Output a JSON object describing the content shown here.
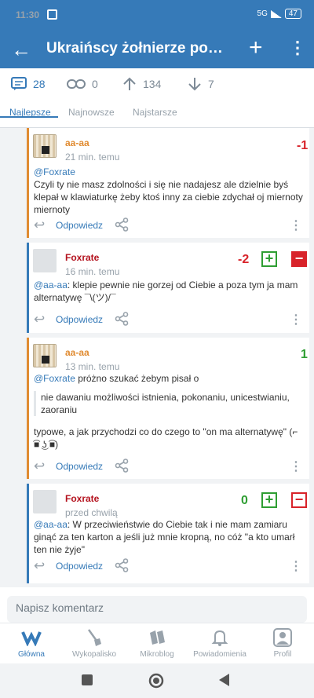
{
  "status": {
    "time": "11:30",
    "network": "5G",
    "battery": "47"
  },
  "appbar": {
    "title": "Ukraińscy żołnierze podd…",
    "back_icon": "arrow-left-icon",
    "add_icon": "plus-icon",
    "more_icon": "more-vert-icon"
  },
  "stats": {
    "comments": "28",
    "links": "0",
    "upvotes": "134",
    "downvotes": "7"
  },
  "tabs": [
    "Najlepsze",
    "Najnowsze",
    "Najstarsze"
  ],
  "colors": {
    "accent": "#367ab8",
    "green": "#2f9e33",
    "red": "#d8232a",
    "orange": "#e08b31"
  },
  "comments": [
    {
      "author": "aa-aa",
      "time": "21 min. temu",
      "score": "-1",
      "mention": "@Foxrate",
      "text": "Czyli ty nie masz zdolności i się nie nadajesz ale dzielnie byś klepał w klawiaturkę żeby ktoś inny za ciebie zdychał oj miernoty miernoty",
      "reply": "Odpowiedz"
    },
    {
      "author": "Foxrate",
      "time": "16 min. temu",
      "score": "-2",
      "mention": "@aa-aa",
      "text": ": klepie pewnie nie gorzej od Ciebie a poza tym ja mam alternatywę ¯\\(ツ)/¯",
      "reply": "Odpowiedz",
      "up": "+",
      "down": "−"
    },
    {
      "author": "aa-aa",
      "time": "13 min. temu",
      "score": "1",
      "mention": "@Foxrate",
      "text": " próżno szukać żebym pisał o",
      "quote": "nie dawaniu możliwości istnienia, pokonaniu, unicestwianiu, zaoraniu",
      "text2": "typowe, a jak przychodzi co do czego to \"on ma alternatywę\" (⌐ ͡■ ͜ʖ ͡■)",
      "reply": "Odpowiedz"
    },
    {
      "author": "Foxrate",
      "time": "przed chwilą",
      "score": "0",
      "mention": "@aa-aa",
      "text": ": W przeciwieństwie do Ciebie tak i nie mam zamiaru ginąć za ten karton a jeśli już mnie kropną, no cóż \"a kto umarł ten nie żyje\"",
      "reply": "Odpowiedz",
      "up": "+",
      "down": "−"
    }
  ],
  "composer": {
    "placeholder": "Napisz komentarz"
  },
  "nav": [
    "Główna",
    "Wykopalisko",
    "Mikroblog",
    "Powiadomienia",
    "Profil"
  ]
}
